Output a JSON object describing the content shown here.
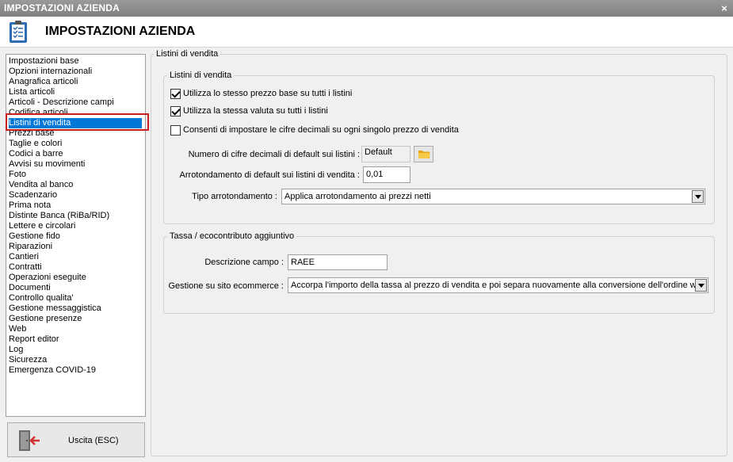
{
  "window": {
    "title": "IMPOSTAZIONI AZIENDA",
    "close_glyph": "×"
  },
  "header": {
    "title": "IMPOSTAZIONI AZIENDA",
    "icon": "clipboard-checklist-icon"
  },
  "sidebar": {
    "items": [
      {
        "label": "Impostazioni base"
      },
      {
        "label": "Opzioni internazionali"
      },
      {
        "label": "Anagrafica articoli"
      },
      {
        "label": "Lista articoli"
      },
      {
        "label": "Articoli - Descrizione campi"
      },
      {
        "label": "Codifica articoli"
      },
      {
        "label": "Listini di vendita",
        "selected": true
      },
      {
        "label": "Prezzi base"
      },
      {
        "label": "Taglie e colori"
      },
      {
        "label": "Codici a barre"
      },
      {
        "label": "Avvisi su movimenti"
      },
      {
        "label": "Foto"
      },
      {
        "label": "Vendita al banco"
      },
      {
        "label": "Scadenzario"
      },
      {
        "label": "Prima nota"
      },
      {
        "label": "Distinte Banca (RiBa/RID)"
      },
      {
        "label": "Lettere e circolari"
      },
      {
        "label": "Gestione fido"
      },
      {
        "label": "Riparazioni"
      },
      {
        "label": "Cantieri"
      },
      {
        "label": "Contratti"
      },
      {
        "label": "Operazioni eseguite"
      },
      {
        "label": "Documenti"
      },
      {
        "label": "Controllo qualita'"
      },
      {
        "label": "Gestione messaggistica"
      },
      {
        "label": "Gestione presenze"
      },
      {
        "label": "Web"
      },
      {
        "label": "Report editor"
      },
      {
        "label": "Log"
      },
      {
        "label": "Sicurezza"
      },
      {
        "label": "Emergenza COVID-19"
      }
    ],
    "exit_label": "Uscita (ESC)",
    "exit_icon": "exit-door-icon"
  },
  "main": {
    "group_title": "Listini di vendita",
    "listini": {
      "title": "Listini di vendita",
      "chk_same_price": {
        "label": "Utilizza lo stesso prezzo base su tutti i listini",
        "checked": true
      },
      "chk_same_currency": {
        "label": "Utilizza la stessa valuta su tutti i listini",
        "checked": true
      },
      "chk_decimals": {
        "label": "Consenti di impostare le cifre decimali su ogni singolo prezzo di vendita",
        "checked": false
      },
      "decimals_label": "Numero di cifre decimali di default sui listini :",
      "decimals_value": "Default",
      "rounding_label": "Arrotondamento di default sui listini di vendita :",
      "rounding_value": "0,01",
      "rounding_type_label": "Tipo arrotondamento :",
      "rounding_type_value": "Applica arrotondamento ai prezzi netti"
    },
    "tassa": {
      "title": "Tassa / ecocontributo aggiuntivo",
      "field_desc_label": "Descrizione campo :",
      "field_desc_value": "RAEE",
      "ecommerce_label": "Gestione su sito ecommerce :",
      "ecommerce_value": "Accorpa l'importo della tassa al prezzo di vendita e poi separa nuovamente alla conversione dell'ordine web"
    }
  },
  "colors": {
    "selection": "#0078d7",
    "highlight_border": "#c81e1e",
    "titlebar": "#8c8c8c"
  }
}
